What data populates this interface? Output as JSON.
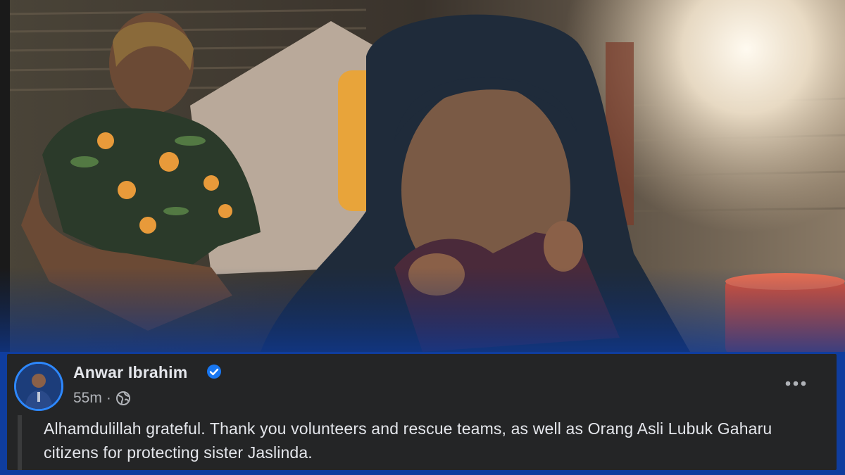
{
  "post": {
    "author": "Anwar Ibrahim",
    "verified_icon": "verified-badge-icon",
    "timestamp": "55m",
    "separator": "·",
    "audience_icon": "globe-icon",
    "more_icon": "more-options-icon",
    "text": "Alhamdulillah grateful. Thank you volunteers and rescue teams, as well as Orang Asli Lubuk Gaharu citizens for protecting sister Jaslinda."
  },
  "colors": {
    "card_background": "#242526",
    "text_primary": "#e4e6eb",
    "text_secondary": "#b0b3b8",
    "verified_blue": "#1877f2"
  }
}
